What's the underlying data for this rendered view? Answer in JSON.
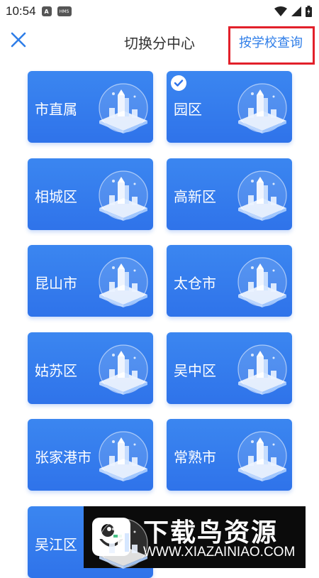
{
  "status_bar": {
    "time": "10:54",
    "icons": [
      "a-notification-icon",
      "hms-icon",
      "wifi-icon",
      "signal-icon",
      "battery-icon"
    ],
    "hms_text": "HMS",
    "a_text": "A"
  },
  "header": {
    "title": "切换分中心",
    "query_label": "按学校查询",
    "close_icon": "close-icon",
    "accent_color": "#2f7ee8",
    "highlight_color": "#e2202a"
  },
  "centers": [
    {
      "label": "市直属",
      "selected": false
    },
    {
      "label": "园区",
      "selected": true
    },
    {
      "label": "相城区",
      "selected": false
    },
    {
      "label": "高新区",
      "selected": false
    },
    {
      "label": "昆山市",
      "selected": false
    },
    {
      "label": "太仓市",
      "selected": false
    },
    {
      "label": "姑苏区",
      "selected": false
    },
    {
      "label": "吴中区",
      "selected": false
    },
    {
      "label": "张家港市",
      "selected": false
    },
    {
      "label": "常熟市",
      "selected": false
    },
    {
      "label": "吴江区",
      "selected": false
    }
  ],
  "card_color": "#3480ee",
  "watermark": {
    "title": "下载鸟资源",
    "url": "WWW.XIAZAINIAO.COM"
  }
}
